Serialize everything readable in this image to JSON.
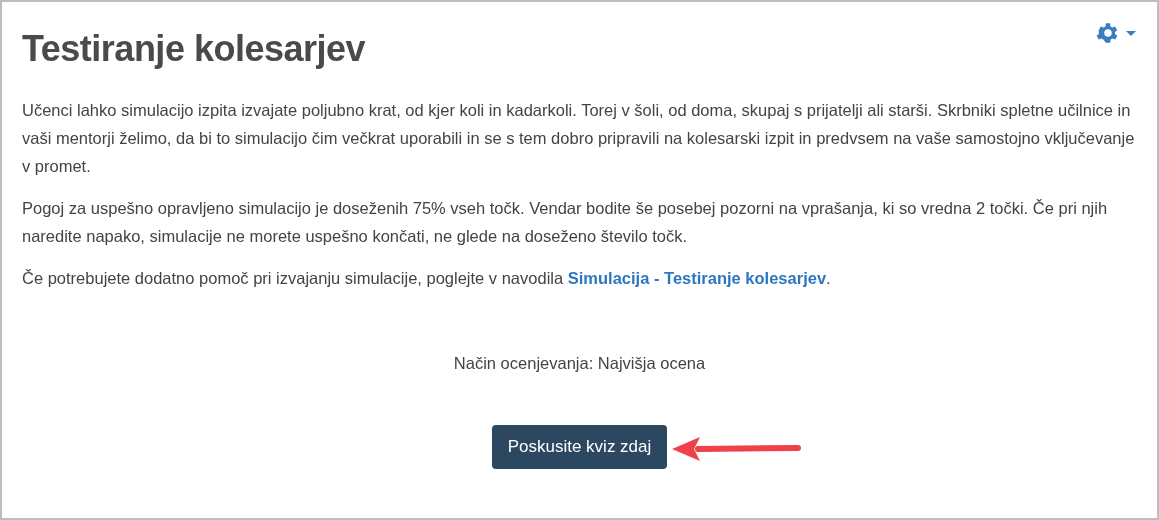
{
  "title": "Testiranje kolesarjev",
  "paragraphs": [
    {
      "text": "Učenci lahko simulacijo izpita izvajate poljubno krat, od kjer koli in kadarkoli. Torej v šoli, od doma, skupaj s prijatelji ali starši. Skrbniki spletne učilnice in vaši mentorji želimo, da bi to simulacijo čim večkrat uporabili in se s tem dobro pripravili na kolesarski izpit in predvsem na vaše samostojno vključevanje v promet."
    },
    {
      "text": "Pogoj za uspešno opravljeno simulacijo je doseženih 75% vseh točk. Vendar bodite še posebej pozorni na vprašanja, ki so vredna 2 točki. Če pri njih naredite napako, simulacije ne morete uspešno končati, ne glede na  doseženo število točk."
    },
    {
      "text": "Če potrebujete dodatno pomoč pri izvajanju simulacije, poglejte v navodila ",
      "link": "Simulacija - Testiranje kolesarjev",
      "after": "."
    }
  ],
  "grading": "Način ocenjevanja: Najvišja ocena",
  "button": "Poskusite kviz zdaj"
}
